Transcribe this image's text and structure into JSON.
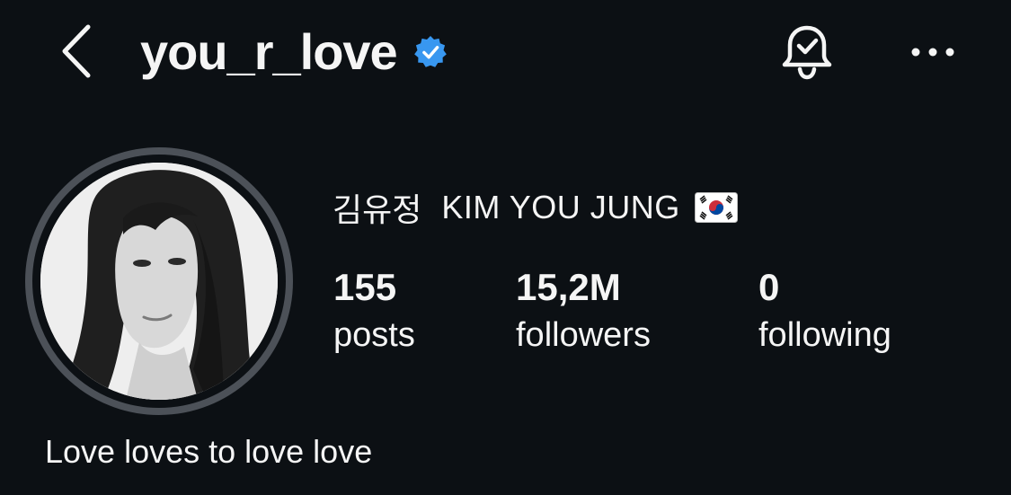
{
  "header": {
    "username": "you_r_love",
    "verified": true,
    "icons": {
      "back": "chevron-left-icon",
      "verified": "verified-badge-icon",
      "notifications": "bell-check-icon",
      "more": "more-horizontal-icon"
    },
    "verified_color": "#3897f0"
  },
  "profile": {
    "name_korean": "김유정",
    "name_english": "KIM YOU JUNG",
    "flag": "south-korea-flag-icon",
    "bio": "Love loves to love love"
  },
  "stats": [
    {
      "value": "155",
      "label": "posts"
    },
    {
      "value": "15,2M",
      "label": "followers"
    },
    {
      "value": "0",
      "label": "following"
    }
  ],
  "colors": {
    "background": "#0c1014",
    "text": "#f5f5f5",
    "avatar_ring": "#4c5158"
  }
}
